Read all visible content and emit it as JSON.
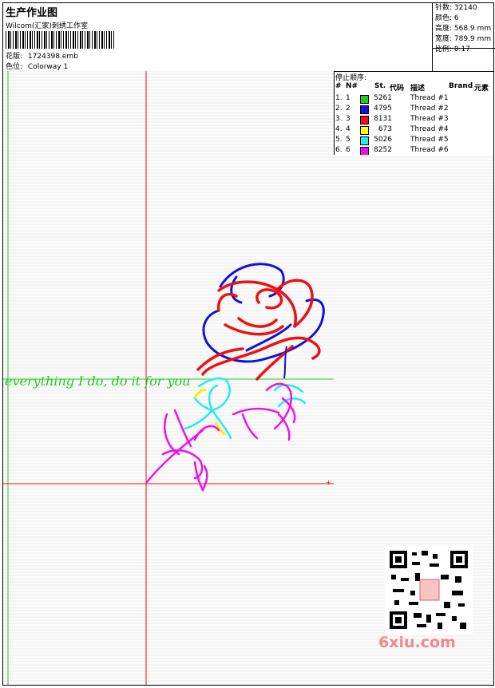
{
  "header": {
    "title": "生产作业图",
    "company": "Wilcom(汇家)刺绣工作室",
    "pattern_label": "花版:",
    "pattern_value": "1724398.emb",
    "colorway_label": "色位:",
    "colorway_value": "Colorway 1"
  },
  "stats": [
    {
      "label": "针数:",
      "value": "32140"
    },
    {
      "label": "颜色:",
      "value": "6"
    },
    {
      "label": "高度:",
      "value": "568.9 mm"
    },
    {
      "label": "宽度:",
      "value": "789.9 mm"
    },
    {
      "label": "比例:",
      "value": "0.17"
    }
  ],
  "stop_sequence": {
    "caption": "停止顺序:",
    "columns": [
      "#",
      "N#",
      "St.",
      "代码",
      "描述",
      "Brand",
      "元素"
    ],
    "rows": [
      {
        "seq": "1.",
        "n": "1",
        "color": "#22cc22",
        "stitches": "5261",
        "desc": "Thread #1"
      },
      {
        "seq": "2.",
        "n": "2",
        "color": "#1111dd",
        "stitches": "4795",
        "desc": "Thread #2"
      },
      {
        "seq": "3.",
        "n": "3",
        "color": "#ee1111",
        "stitches": "8131",
        "desc": "Thread #3"
      },
      {
        "seq": "4.",
        "n": "4",
        "color": "#ffff00",
        "stitches": "673",
        "desc": "Thread #4"
      },
      {
        "seq": "5.",
        "n": "5",
        "color": "#22eeee",
        "stitches": "5026",
        "desc": "Thread #5"
      },
      {
        "seq": "6.",
        "n": "6",
        "color": "#ee11ee",
        "stitches": "8252",
        "desc": "Thread #6"
      }
    ]
  },
  "design": {
    "text": "everything I do, do it for you"
  },
  "watermark": "6xiu.com"
}
